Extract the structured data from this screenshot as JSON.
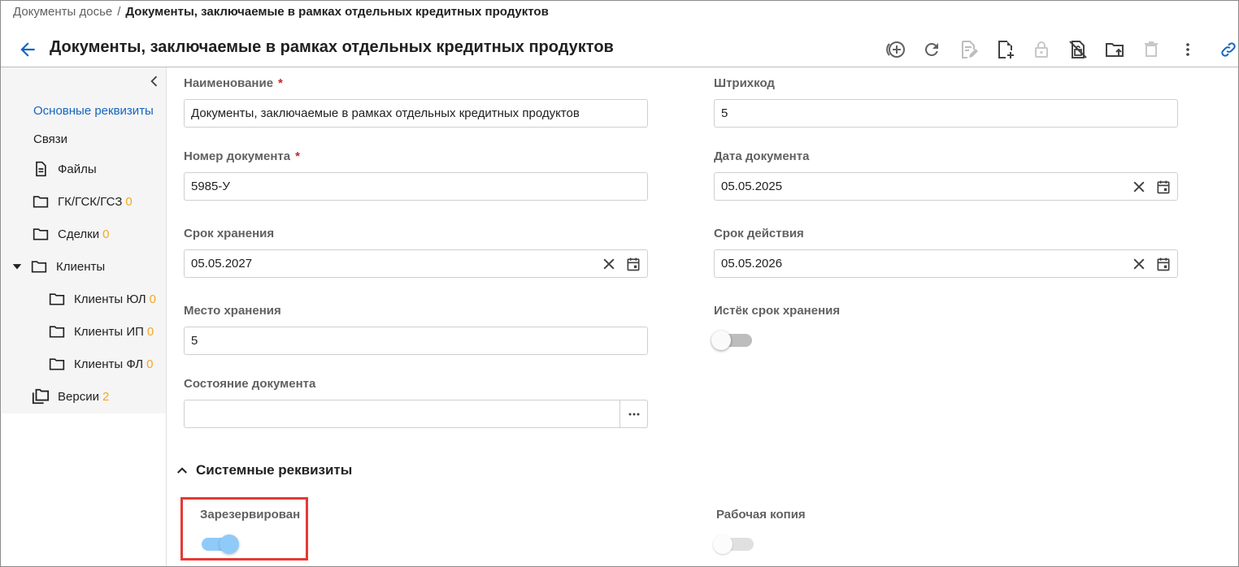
{
  "breadcrumb": {
    "parent": "Документы досье",
    "separator": "/",
    "current": "Документы, заключаемые в рамках отдельных кредитных продуктов"
  },
  "header": {
    "title": "Документы, заключаемые в рамках отдельных кредитных продуктов",
    "toolbar_icons": [
      "add-circle-icon",
      "refresh-icon",
      "edit-document-icon",
      "add-document-icon",
      "lock-icon",
      "unlock-document-icon",
      "folder-move-icon",
      "delete-icon",
      "more-vert-icon",
      "link-icon"
    ]
  },
  "sidebar": {
    "items": [
      {
        "label": "Основные реквизиты",
        "icon": null,
        "count": null,
        "active": true
      },
      {
        "label": "Связи",
        "icon": null,
        "count": null
      },
      {
        "label": "Файлы",
        "icon": "file-icon",
        "count": null
      },
      {
        "label": "ГК/ГСК/ГСЗ",
        "icon": "folder-icon",
        "count": "0"
      },
      {
        "label": "Сделки",
        "icon": "folder-icon",
        "count": "0"
      },
      {
        "label": "Клиенты",
        "icon": "folder-icon",
        "count": null,
        "expanded": true
      },
      {
        "label": "Клиенты ЮЛ",
        "icon": "folder-icon",
        "count": "0"
      },
      {
        "label": "Клиенты ИП",
        "icon": "folder-icon",
        "count": "0"
      },
      {
        "label": "Клиенты ФЛ",
        "icon": "folder-icon",
        "count": "0"
      },
      {
        "label": "Версии",
        "icon": "versions-icon",
        "count": "2"
      }
    ]
  },
  "form": {
    "name": {
      "label": "Наименование",
      "required_mark": "*",
      "value": "Документы, заключаемые в рамках отдельных кредитных продуктов"
    },
    "barcode": {
      "label": "Штрихкод",
      "value": "5"
    },
    "doc_number": {
      "label": "Номер документа",
      "required_mark": "*",
      "value": "5985-У"
    },
    "doc_date": {
      "label": "Дата документа",
      "value": "05.05.2025"
    },
    "storage_period": {
      "label": "Срок хранения",
      "value": "05.05.2027"
    },
    "validity_period": {
      "label": "Срок действия",
      "value": "05.05.2026"
    },
    "storage_place": {
      "label": "Место хранения",
      "value": "5"
    },
    "storage_expired": {
      "label": "Истёк срок хранения",
      "checked": false
    },
    "doc_state": {
      "label": "Состояние документа",
      "value": ""
    }
  },
  "system_section": {
    "title": "Системные реквизиты",
    "expanded": true,
    "reserved": {
      "label": "Зарезервирован",
      "checked": true
    },
    "working_copy": {
      "label": "Рабочая копия",
      "checked": false
    }
  },
  "colors": {
    "accent": "#1565c0",
    "count": "#f5a623",
    "required": "#c62828",
    "highlight": "#e53935",
    "toggle_on": "#90caf9"
  }
}
